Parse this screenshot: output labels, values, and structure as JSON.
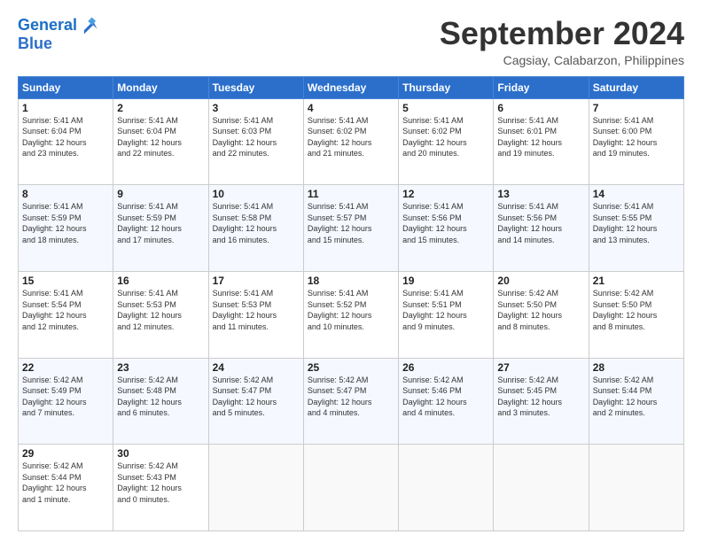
{
  "header": {
    "logo_line1": "General",
    "logo_line2": "Blue",
    "month": "September 2024",
    "location": "Cagsiay, Calabarzon, Philippines"
  },
  "weekdays": [
    "Sunday",
    "Monday",
    "Tuesday",
    "Wednesday",
    "Thursday",
    "Friday",
    "Saturday"
  ],
  "weeks": [
    [
      {
        "day": "1",
        "lines": [
          "Sunrise: 5:41 AM",
          "Sunset: 6:04 PM",
          "Daylight: 12 hours",
          "and 23 minutes."
        ]
      },
      {
        "day": "2",
        "lines": [
          "Sunrise: 5:41 AM",
          "Sunset: 6:04 PM",
          "Daylight: 12 hours",
          "and 22 minutes."
        ]
      },
      {
        "day": "3",
        "lines": [
          "Sunrise: 5:41 AM",
          "Sunset: 6:03 PM",
          "Daylight: 12 hours",
          "and 22 minutes."
        ]
      },
      {
        "day": "4",
        "lines": [
          "Sunrise: 5:41 AM",
          "Sunset: 6:02 PM",
          "Daylight: 12 hours",
          "and 21 minutes."
        ]
      },
      {
        "day": "5",
        "lines": [
          "Sunrise: 5:41 AM",
          "Sunset: 6:02 PM",
          "Daylight: 12 hours",
          "and 20 minutes."
        ]
      },
      {
        "day": "6",
        "lines": [
          "Sunrise: 5:41 AM",
          "Sunset: 6:01 PM",
          "Daylight: 12 hours",
          "and 19 minutes."
        ]
      },
      {
        "day": "7",
        "lines": [
          "Sunrise: 5:41 AM",
          "Sunset: 6:00 PM",
          "Daylight: 12 hours",
          "and 19 minutes."
        ]
      }
    ],
    [
      {
        "day": "8",
        "lines": [
          "Sunrise: 5:41 AM",
          "Sunset: 5:59 PM",
          "Daylight: 12 hours",
          "and 18 minutes."
        ]
      },
      {
        "day": "9",
        "lines": [
          "Sunrise: 5:41 AM",
          "Sunset: 5:59 PM",
          "Daylight: 12 hours",
          "and 17 minutes."
        ]
      },
      {
        "day": "10",
        "lines": [
          "Sunrise: 5:41 AM",
          "Sunset: 5:58 PM",
          "Daylight: 12 hours",
          "and 16 minutes."
        ]
      },
      {
        "day": "11",
        "lines": [
          "Sunrise: 5:41 AM",
          "Sunset: 5:57 PM",
          "Daylight: 12 hours",
          "and 15 minutes."
        ]
      },
      {
        "day": "12",
        "lines": [
          "Sunrise: 5:41 AM",
          "Sunset: 5:56 PM",
          "Daylight: 12 hours",
          "and 15 minutes."
        ]
      },
      {
        "day": "13",
        "lines": [
          "Sunrise: 5:41 AM",
          "Sunset: 5:56 PM",
          "Daylight: 12 hours",
          "and 14 minutes."
        ]
      },
      {
        "day": "14",
        "lines": [
          "Sunrise: 5:41 AM",
          "Sunset: 5:55 PM",
          "Daylight: 12 hours",
          "and 13 minutes."
        ]
      }
    ],
    [
      {
        "day": "15",
        "lines": [
          "Sunrise: 5:41 AM",
          "Sunset: 5:54 PM",
          "Daylight: 12 hours",
          "and 12 minutes."
        ]
      },
      {
        "day": "16",
        "lines": [
          "Sunrise: 5:41 AM",
          "Sunset: 5:53 PM",
          "Daylight: 12 hours",
          "and 12 minutes."
        ]
      },
      {
        "day": "17",
        "lines": [
          "Sunrise: 5:41 AM",
          "Sunset: 5:53 PM",
          "Daylight: 12 hours",
          "and 11 minutes."
        ]
      },
      {
        "day": "18",
        "lines": [
          "Sunrise: 5:41 AM",
          "Sunset: 5:52 PM",
          "Daylight: 12 hours",
          "and 10 minutes."
        ]
      },
      {
        "day": "19",
        "lines": [
          "Sunrise: 5:41 AM",
          "Sunset: 5:51 PM",
          "Daylight: 12 hours",
          "and 9 minutes."
        ]
      },
      {
        "day": "20",
        "lines": [
          "Sunrise: 5:42 AM",
          "Sunset: 5:50 PM",
          "Daylight: 12 hours",
          "and 8 minutes."
        ]
      },
      {
        "day": "21",
        "lines": [
          "Sunrise: 5:42 AM",
          "Sunset: 5:50 PM",
          "Daylight: 12 hours",
          "and 8 minutes."
        ]
      }
    ],
    [
      {
        "day": "22",
        "lines": [
          "Sunrise: 5:42 AM",
          "Sunset: 5:49 PM",
          "Daylight: 12 hours",
          "and 7 minutes."
        ]
      },
      {
        "day": "23",
        "lines": [
          "Sunrise: 5:42 AM",
          "Sunset: 5:48 PM",
          "Daylight: 12 hours",
          "and 6 minutes."
        ]
      },
      {
        "day": "24",
        "lines": [
          "Sunrise: 5:42 AM",
          "Sunset: 5:47 PM",
          "Daylight: 12 hours",
          "and 5 minutes."
        ]
      },
      {
        "day": "25",
        "lines": [
          "Sunrise: 5:42 AM",
          "Sunset: 5:47 PM",
          "Daylight: 12 hours",
          "and 4 minutes."
        ]
      },
      {
        "day": "26",
        "lines": [
          "Sunrise: 5:42 AM",
          "Sunset: 5:46 PM",
          "Daylight: 12 hours",
          "and 4 minutes."
        ]
      },
      {
        "day": "27",
        "lines": [
          "Sunrise: 5:42 AM",
          "Sunset: 5:45 PM",
          "Daylight: 12 hours",
          "and 3 minutes."
        ]
      },
      {
        "day": "28",
        "lines": [
          "Sunrise: 5:42 AM",
          "Sunset: 5:44 PM",
          "Daylight: 12 hours",
          "and 2 minutes."
        ]
      }
    ],
    [
      {
        "day": "29",
        "lines": [
          "Sunrise: 5:42 AM",
          "Sunset: 5:44 PM",
          "Daylight: 12 hours",
          "and 1 minute."
        ]
      },
      {
        "day": "30",
        "lines": [
          "Sunrise: 5:42 AM",
          "Sunset: 5:43 PM",
          "Daylight: 12 hours",
          "and 0 minutes."
        ]
      },
      {
        "day": "",
        "lines": []
      },
      {
        "day": "",
        "lines": []
      },
      {
        "day": "",
        "lines": []
      },
      {
        "day": "",
        "lines": []
      },
      {
        "day": "",
        "lines": []
      }
    ]
  ]
}
